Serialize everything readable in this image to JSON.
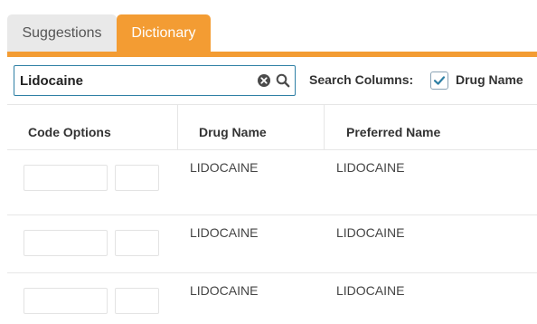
{
  "tabs": [
    {
      "label": "Suggestions",
      "active": false
    },
    {
      "label": "Dictionary",
      "active": true
    }
  ],
  "colors": {
    "accent": "#f39c33",
    "inactive_tab": "#e9e9e9",
    "search_border": "#2f80a5",
    "checkmark": "#2f80a5"
  },
  "search": {
    "value": "Lidocaine",
    "placeholder": "",
    "clear_icon": "clear-icon",
    "search_icon": "search-icon"
  },
  "search_columns": {
    "label": "Search Columns:",
    "options": [
      {
        "label": "Drug Name",
        "checked": true
      }
    ]
  },
  "table": {
    "headers": [
      "Code Options",
      "Drug Name",
      "Preferred Name"
    ],
    "rows": [
      {
        "drug_name": "LIDOCAINE",
        "preferred_name": "LIDOCAINE"
      },
      {
        "drug_name": "LIDOCAINE",
        "preferred_name": "LIDOCAINE"
      },
      {
        "drug_name": "LIDOCAINE",
        "preferred_name": "LIDOCAINE"
      }
    ]
  }
}
